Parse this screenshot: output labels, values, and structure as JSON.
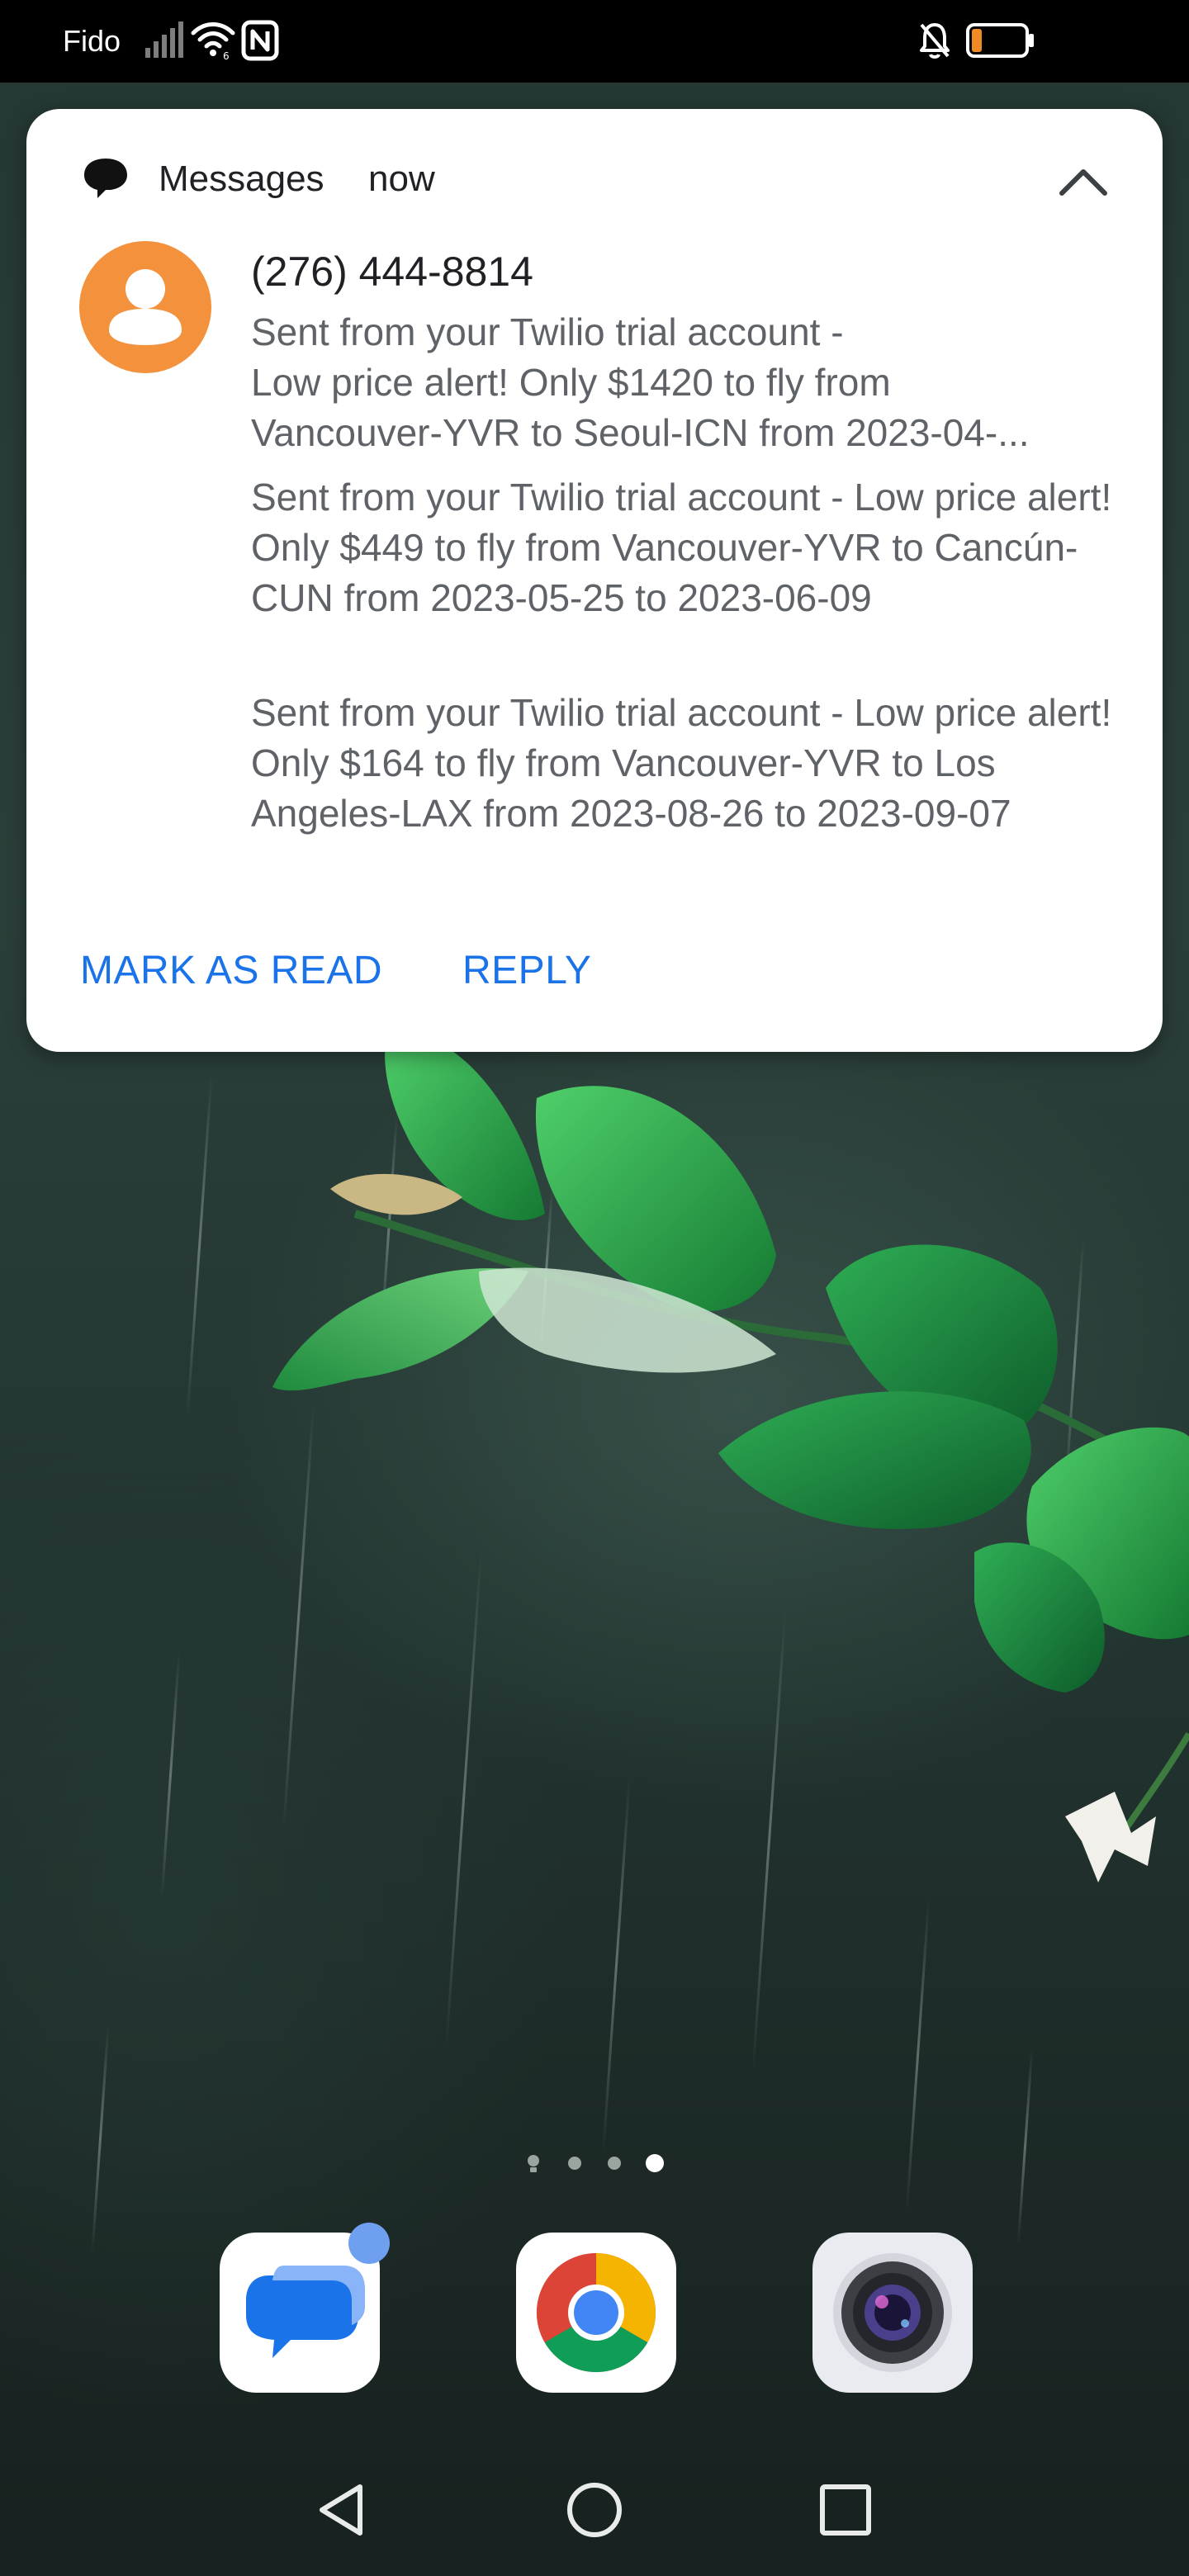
{
  "status_bar": {
    "carrier": "Fido",
    "icons": [
      "signal-icon",
      "wifi-icon",
      "nfc-icon",
      "notifications-off-icon",
      "battery-icon"
    ],
    "battery_level": 0.2,
    "battery_color": "#f08a24"
  },
  "notification": {
    "app_name": "Messages",
    "time": "now",
    "sender": "(276) 444-8814",
    "messages": [
      {
        "lines": [
          "Sent from your Twilio trial account -",
          "Low price alert! Only $1420 to fly from",
          "Vancouver-YVR to Seoul-ICN from 2023-04-..."
        ]
      },
      {
        "text": "Sent from your Twilio trial account - Low price alert! Only $449 to fly from Vancouver-YVR to Cancún-CUN from 2023-05-25 to 2023-06-09"
      },
      {
        "text": "Sent from your Twilio trial account - Low price alert! Only $164 to fly from Vancouver-YVR to Los Angeles-LAX from 2023-08-26 to 2023-09-07"
      }
    ],
    "actions": {
      "mark_as_read": "MARK AS READ",
      "reply": "REPLY"
    },
    "avatar_color": "#f4913d",
    "action_color": "#1a73e8"
  },
  "home_screen": {
    "page_indicator": {
      "pages": 4,
      "current": 4
    },
    "dock": [
      {
        "name": "Messages",
        "icon": "messages-icon",
        "has_badge": true
      },
      {
        "name": "Chrome",
        "icon": "chrome-icon",
        "has_badge": false
      },
      {
        "name": "Camera",
        "icon": "camera-icon",
        "has_badge": false
      }
    ]
  },
  "navigation_bar": {
    "buttons": [
      "back-icon",
      "home-icon",
      "recents-icon"
    ]
  }
}
